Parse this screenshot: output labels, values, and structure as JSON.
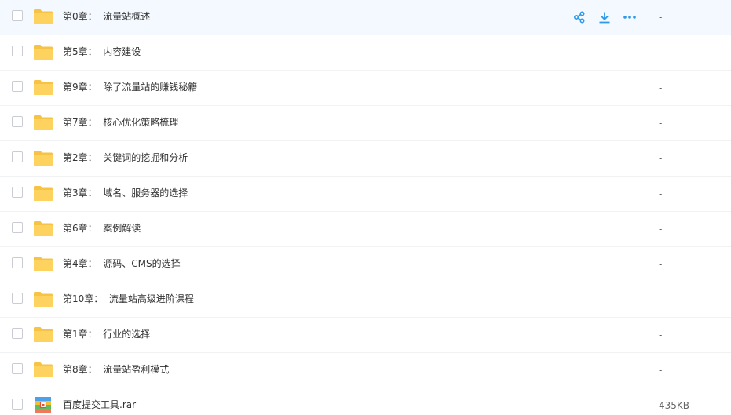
{
  "files": [
    {
      "name": "第0章：  流量站概述",
      "size": "-",
      "type": "folder",
      "hover": true
    },
    {
      "name": "第5章：  内容建设",
      "size": "-",
      "type": "folder"
    },
    {
      "name": "第9章：  除了流量站的赚钱秘籍",
      "size": "-",
      "type": "folder"
    },
    {
      "name": "第7章：  核心优化策略梳理",
      "size": "-",
      "type": "folder"
    },
    {
      "name": "第2章：  关键词的挖掘和分析",
      "size": "-",
      "type": "folder"
    },
    {
      "name": "第3章：  域名、服务器的选择",
      "size": "-",
      "type": "folder"
    },
    {
      "name": "第6章：  案例解读",
      "size": "-",
      "type": "folder"
    },
    {
      "name": "第4章：  源码、CMS的选择",
      "size": "-",
      "type": "folder"
    },
    {
      "name": "第10章：  流量站高级进阶课程",
      "size": "-",
      "type": "folder"
    },
    {
      "name": "第1章：  行业的选择",
      "size": "-",
      "type": "folder"
    },
    {
      "name": "第8章：  流量站盈利模式",
      "size": "-",
      "type": "folder"
    },
    {
      "name": "百度提交工具.rar",
      "size": "435KB",
      "type": "rar"
    }
  ],
  "row_actions": [
    "share-icon",
    "download-icon",
    "more-icon"
  ],
  "colors": {
    "accent": "#2c9ae8",
    "folder": "#fdd25f",
    "hover_bg": "#f4f9ff"
  }
}
